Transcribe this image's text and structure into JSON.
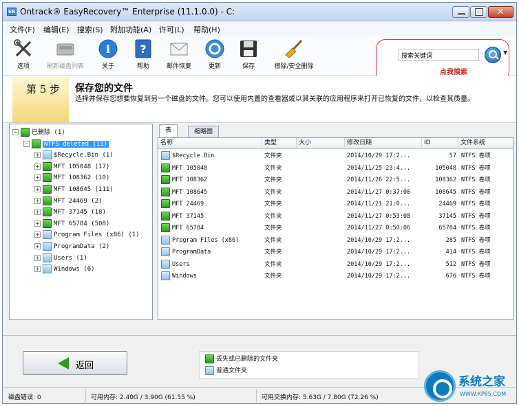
{
  "window": {
    "title": "Ontrack® EasyRecovery™ Enterprise (11.1.0.0) - C:",
    "app_icon": "ER"
  },
  "menu": [
    "文件(F)",
    "编辑(E)",
    "搜索(S)",
    "附加功能(A)",
    "许可(L)",
    "帮助(H)"
  ],
  "toolbar": [
    {
      "label": "选项",
      "icon": "tools-icon",
      "enabled": true
    },
    {
      "label": "刷新磁盘列表",
      "icon": "disk-icon",
      "enabled": false
    },
    {
      "label": "关于",
      "icon": "info-icon",
      "enabled": true
    },
    {
      "label": "帮助",
      "icon": "help-icon",
      "enabled": true
    },
    {
      "label": "邮件恢复",
      "icon": "mail-icon",
      "enabled": true
    },
    {
      "label": "更新",
      "icon": "update-icon",
      "enabled": true
    },
    {
      "label": "保存",
      "icon": "save-icon",
      "enabled": true
    },
    {
      "label": "擦除/安全删除",
      "icon": "broom-icon",
      "enabled": true
    }
  ],
  "search": {
    "value": "搜索关键词",
    "annotation": "点我搜索"
  },
  "step": {
    "label": "第 5 步",
    "title": "保存您的文件",
    "description": "选择并保存您想要恢复到另一个磁盘的文件。您可以使用内置的查看器或以其关联的应用程序来打开已恢复的文件，以检查其质量。"
  },
  "tree": [
    {
      "label": "已删除 (1)",
      "level": 0,
      "color": "green",
      "expander": "-",
      "selected": false
    },
    {
      "label": "NTFS deleted (11)",
      "level": 1,
      "color": "green",
      "expander": "-",
      "selected": true
    },
    {
      "label": "$Recycle.Bin (1)",
      "level": 2,
      "color": "blue",
      "expander": "+",
      "selected": false
    },
    {
      "label": "MFT 105048 (17)",
      "level": 2,
      "color": "green",
      "expander": "+",
      "selected": false
    },
    {
      "label": "MFT 108362 (10)",
      "level": 2,
      "color": "green",
      "expander": "+",
      "selected": false
    },
    {
      "label": "MFT 108645 (111)",
      "level": 2,
      "color": "green",
      "expander": "+",
      "selected": false
    },
    {
      "label": "MFT 24469 (2)",
      "level": 2,
      "color": "green",
      "expander": "+",
      "selected": false
    },
    {
      "label": "MFT 37145 (18)",
      "level": 2,
      "color": "green",
      "expander": "+",
      "selected": false
    },
    {
      "label": "MFT 65784 (508)",
      "level": 2,
      "color": "green",
      "expander": "+",
      "selected": false
    },
    {
      "label": "Program Files (x86) (1)",
      "level": 2,
      "color": "blue",
      "expander": "+",
      "selected": false
    },
    {
      "label": "ProgramData (2)",
      "level": 2,
      "color": "blue",
      "expander": "+",
      "selected": false
    },
    {
      "label": "Users (1)",
      "level": 2,
      "color": "blue",
      "expander": "+",
      "selected": false
    },
    {
      "label": "Windows (6)",
      "level": 2,
      "color": "blue",
      "expander": "+",
      "selected": false
    }
  ],
  "tabs": [
    "表",
    "缩略图"
  ],
  "columns": [
    "名称",
    "类型",
    "大小",
    "修改日期",
    "ID",
    "文件系统"
  ],
  "rows": [
    {
      "name": "$Recycle.Bin",
      "color": "blue",
      "type": "文件夹",
      "size": "",
      "date": "2014/10/29 17:2...",
      "id": "57",
      "fs": "NTFS 卷项"
    },
    {
      "name": "MFT 105048",
      "color": "green",
      "type": "文件夹",
      "size": "",
      "date": "2014/11/25 23:4...",
      "id": "105048",
      "fs": "NTFS 卷项"
    },
    {
      "name": "MFT 108362",
      "color": "green",
      "type": "文件夹",
      "size": "",
      "date": "2014/11/26 22:5...",
      "id": "108362",
      "fs": "NTFS 卷项"
    },
    {
      "name": "MFT 108645",
      "color": "green",
      "type": "文件夹",
      "size": "",
      "date": "2014/11/27 0:37:00",
      "id": "108645",
      "fs": "NTFS 卷项"
    },
    {
      "name": "MFT 24469",
      "color": "green",
      "type": "文件夹",
      "size": "",
      "date": "2014/11/21 21:0...",
      "id": "24469",
      "fs": "NTFS 卷项"
    },
    {
      "name": "MFT 37145",
      "color": "green",
      "type": "文件夹",
      "size": "",
      "date": "2014/11/27 0:53:08",
      "id": "37145",
      "fs": "NTFS 卷项"
    },
    {
      "name": "MFT 65784",
      "color": "green",
      "type": "文件夹",
      "size": "",
      "date": "2014/11/27 0:50:06",
      "id": "65784",
      "fs": "NTFS 卷项"
    },
    {
      "name": "Program Files (x86)",
      "color": "blue",
      "type": "文件夹",
      "size": "",
      "date": "2014/10/29 17:2...",
      "id": "285",
      "fs": "NTFS 卷项"
    },
    {
      "name": "ProgramData",
      "color": "blue",
      "type": "文件夹",
      "size": "",
      "date": "2014/10/29 17:2...",
      "id": "414",
      "fs": "NTFS 卷项"
    },
    {
      "name": "Users",
      "color": "blue",
      "type": "文件夹",
      "size": "",
      "date": "2014/10/29 17:2...",
      "id": "512",
      "fs": "NTFS 卷项"
    },
    {
      "name": "Windows",
      "color": "blue",
      "type": "文件夹",
      "size": "",
      "date": "2014/10/29 17:2...",
      "id": "676",
      "fs": "NTFS 卷项"
    }
  ],
  "back_button": "返回",
  "legend": [
    {
      "color": "green",
      "label": "丢失或已删除的文件夹"
    },
    {
      "color": "blue",
      "label": "普通文件夹"
    }
  ],
  "status": {
    "disk_errors": "磁盘错误: 0",
    "memory": "可用内存: 2.40G / 3.90G (61.55 %)",
    "swap": "可用交换内存: 5.63G / 7.80G (72.26 %)"
  },
  "watermark": {
    "title": "系统之家",
    "url": "WWW.XP85.COM"
  },
  "colors": {
    "deleted_folder": "#2b9b1f",
    "normal_folder": "#8fc1ea",
    "selection": "#3399ff",
    "annotation": "#d12121"
  }
}
